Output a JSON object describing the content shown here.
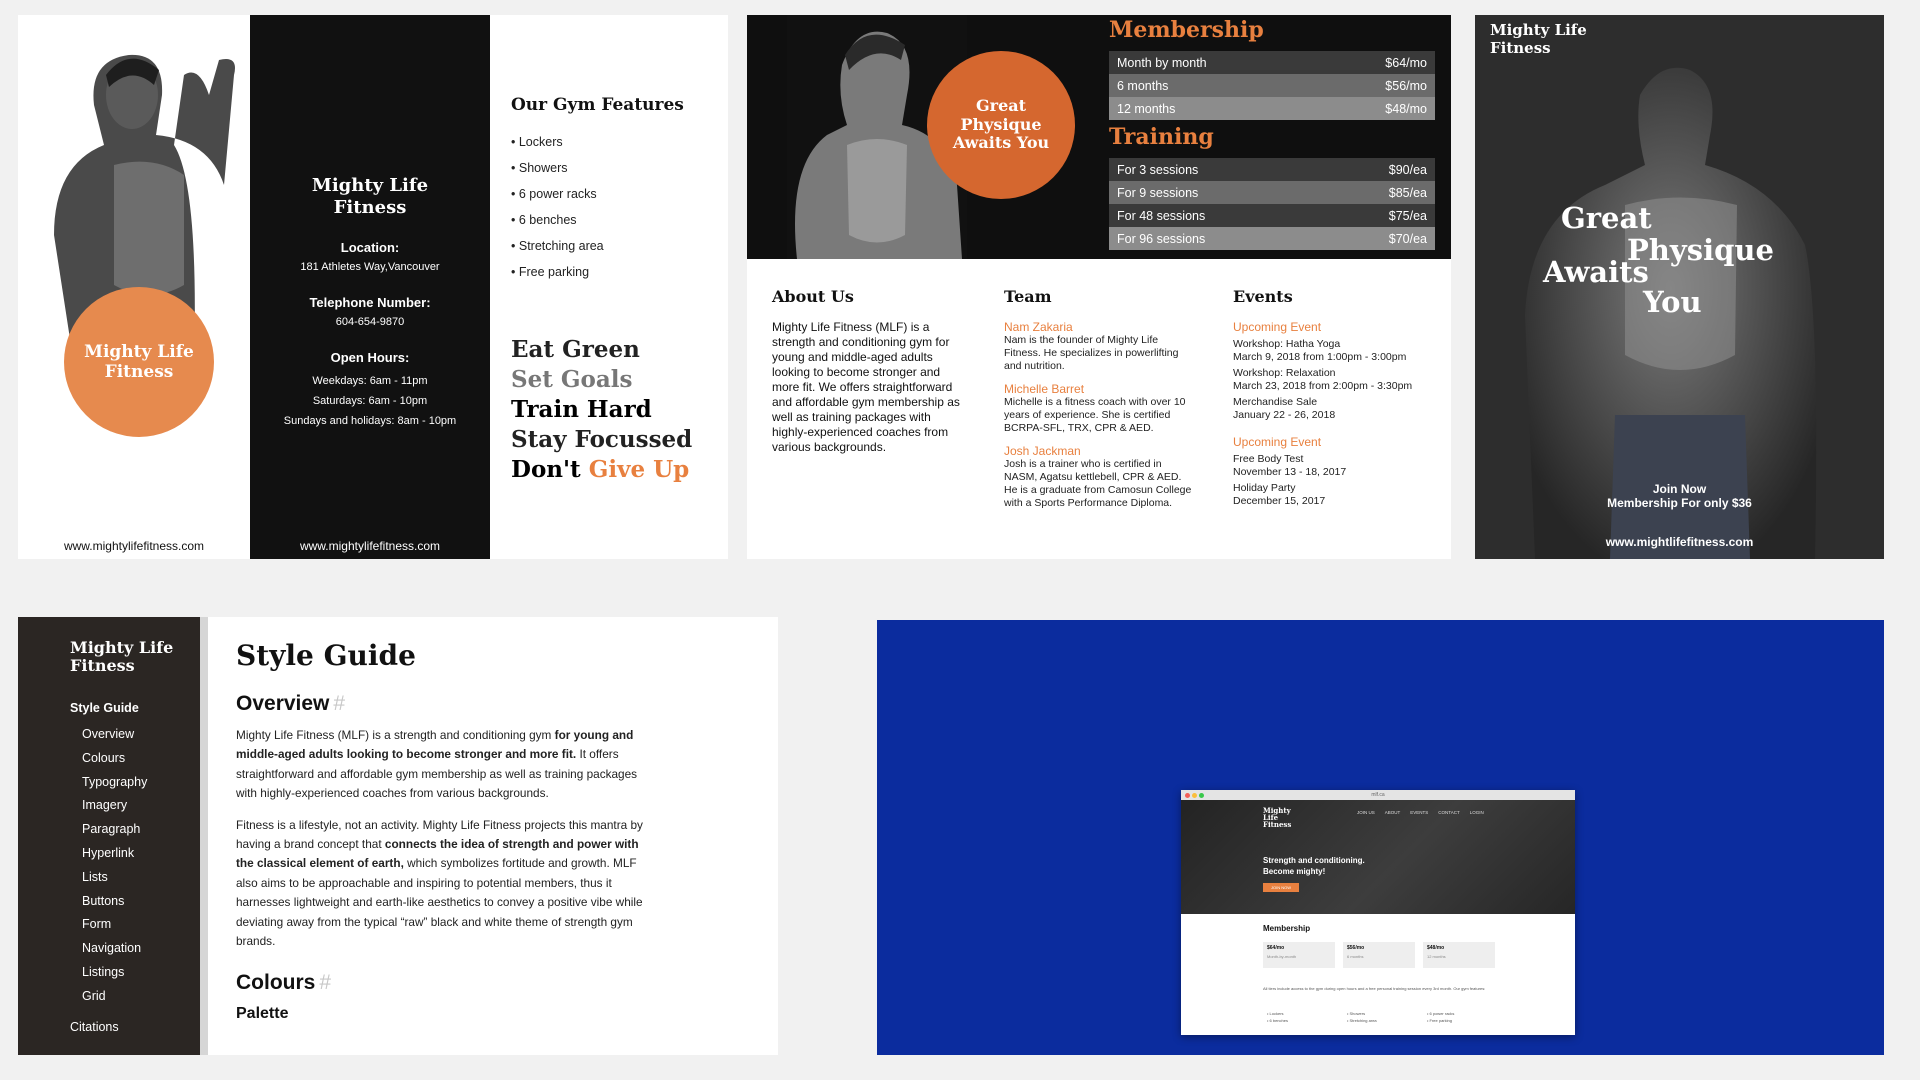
{
  "brochure": {
    "brand": "Mighty Life Fitness",
    "url": "www.mightylifefitness.com",
    "location_label": "Location:",
    "location_value": "181 Athletes Way,Vancouver",
    "phone_label": "Telephone Number:",
    "phone_value": "604-654-9870",
    "hours_label": "Open Hours:",
    "hours": [
      "Weekdays: 6am - 11pm",
      "Saturdays: 6am - 10pm",
      "Sundays and holidays: 8am - 10pm"
    ],
    "features_title": "Our Gym Features",
    "features": [
      "Lockers",
      "Showers",
      "6 power racks",
      "6 benches",
      "Stretching area",
      "Free parking"
    ],
    "slogans": [
      "Eat Green",
      "Set Goals",
      "Train Hard",
      "Stay Focussed"
    ],
    "slogan_last_prefix": "Don't",
    "slogan_last_accent": "Give Up"
  },
  "flyer": {
    "circle_text": "Great Physique Awaits You",
    "membership_title": "Membership",
    "membership": [
      {
        "label": "Month by month",
        "price": "$64/mo"
      },
      {
        "label": "6 months",
        "price": "$56/mo"
      },
      {
        "label": "12 months",
        "price": "$48/mo"
      }
    ],
    "training_title": "Training",
    "training": [
      {
        "label": "For 3 sessions",
        "price": "$90/ea"
      },
      {
        "label": "For 9 sessions",
        "price": "$85/ea"
      },
      {
        "label": "For 48 sessions",
        "price": "$75/ea"
      },
      {
        "label": "For 96 sessions",
        "price": "$70/ea"
      }
    ],
    "about_title": "About Us",
    "about_text": "Mighty Life Fitness (MLF) is a strength and conditioning gym for young and middle-aged adults looking to become stronger and more fit. We offers straightforward and affordable gym membership as well as training packages with highly-experienced coaches from various backgrounds.",
    "team_title": "Team",
    "team": [
      {
        "name": "Nam Zakaria",
        "bio": "Nam is the founder of Mighty Life Fitness. He specializes in powerlifting and nutrition."
      },
      {
        "name": "Michelle Barret",
        "bio": "Michelle is a fitness coach with over 10 years of experience. She is certified BCRPA-SFL, TRX, CPR & AED."
      },
      {
        "name": "Josh Jackman",
        "bio": "Josh is a trainer who is certified in NASM, Agatsu kettlebell, CPR & AED. He is a graduate from Camosun College with a Sports Performance Diploma."
      }
    ],
    "events_title": "Events",
    "event_groups": [
      {
        "title": "Upcoming Event",
        "items": [
          {
            "name": "Workshop: Hatha Yoga",
            "date": "March 9, 2018 from 1:00pm - 3:00pm"
          },
          {
            "name": "Workshop: Relaxation",
            "date": "March 23, 2018 from 2:00pm - 3:30pm"
          },
          {
            "name": "Merchandise Sale",
            "date": "January 22 - 26, 2018"
          }
        ]
      },
      {
        "title": "Upcoming Event",
        "items": [
          {
            "name": "Free Body Test",
            "date": "November 13 - 18, 2017"
          },
          {
            "name": "Holiday Party",
            "date": "December 15, 2017"
          }
        ]
      }
    ]
  },
  "poster": {
    "brand": "Mighty Life Fitness",
    "words": [
      "Great",
      "Physique",
      "Awaits",
      "You"
    ],
    "join_line1": "Join Now",
    "join_line2": "Membership For only $36",
    "url": "www.mightlifefitness.com"
  },
  "styleguide": {
    "brand": "Mighty Life Fitness",
    "main_link": "Style Guide",
    "nav": [
      "Overview",
      "Colours",
      "Typography",
      "Imagery",
      "Paragraph",
      "Hyperlink",
      "Lists",
      "Buttons",
      "Form",
      "Navigation",
      "Listings",
      "Grid"
    ],
    "citations": "Citations",
    "title": "Style Guide",
    "overview_heading": "Overview",
    "hash": "#",
    "p1_a": "Mighty Life Fitness (MLF) is a strength and conditioning gym ",
    "p1_b": "for young and middle-aged adults looking to become stronger and more fit.",
    "p1_c": " It offers straightforward and affordable gym membership as well as training packages with highly-experienced coaches from various backgrounds.",
    "p2_a": "Fitness is a lifestyle, not an activity. Mighty Life Fitness projects this mantra by having a brand concept that ",
    "p2_b": "connects the idea of strength and power with the classical element of earth,",
    "p2_c": " which symbolizes fortitude and growth. MLF also aims to be approachable and inspiring to potential members, thus it harnesses lightweight and earth-like aesthetics to convey a positive vibe while deviating away from the typical “raw” black and white theme of strength gym brands.",
    "colours_heading": "Colours",
    "palette_heading": "Palette"
  },
  "website": {
    "url": "mlf.ca",
    "brand": "Mighty Life Fitness",
    "nav": [
      "JOIN US",
      "ABOUT",
      "EVENTS",
      "CONTACT",
      "LOGIN"
    ],
    "hero_text": "Strength and conditioning. Become mighty!",
    "cta": "JOIN NOW",
    "membership_title": "Membership",
    "plans": [
      {
        "price": "$64/mo",
        "term": "Month-by-month"
      },
      {
        "price": "$56/mo",
        "term": "6 months"
      },
      {
        "price": "$48/mo",
        "term": "12 months"
      }
    ],
    "info": "All tiers include access to the gym during open hours and a free personal training session every 3rd month. Our gym features:",
    "features": [
      "Lockers",
      "Showers",
      "6 power racks",
      "6 benches",
      "Stretching area",
      "Free parking"
    ]
  },
  "colors": {
    "accent": "#e8803f",
    "dark": "#111111",
    "sidebar": "#2b2623",
    "website_bg": "#0b2c9e"
  }
}
